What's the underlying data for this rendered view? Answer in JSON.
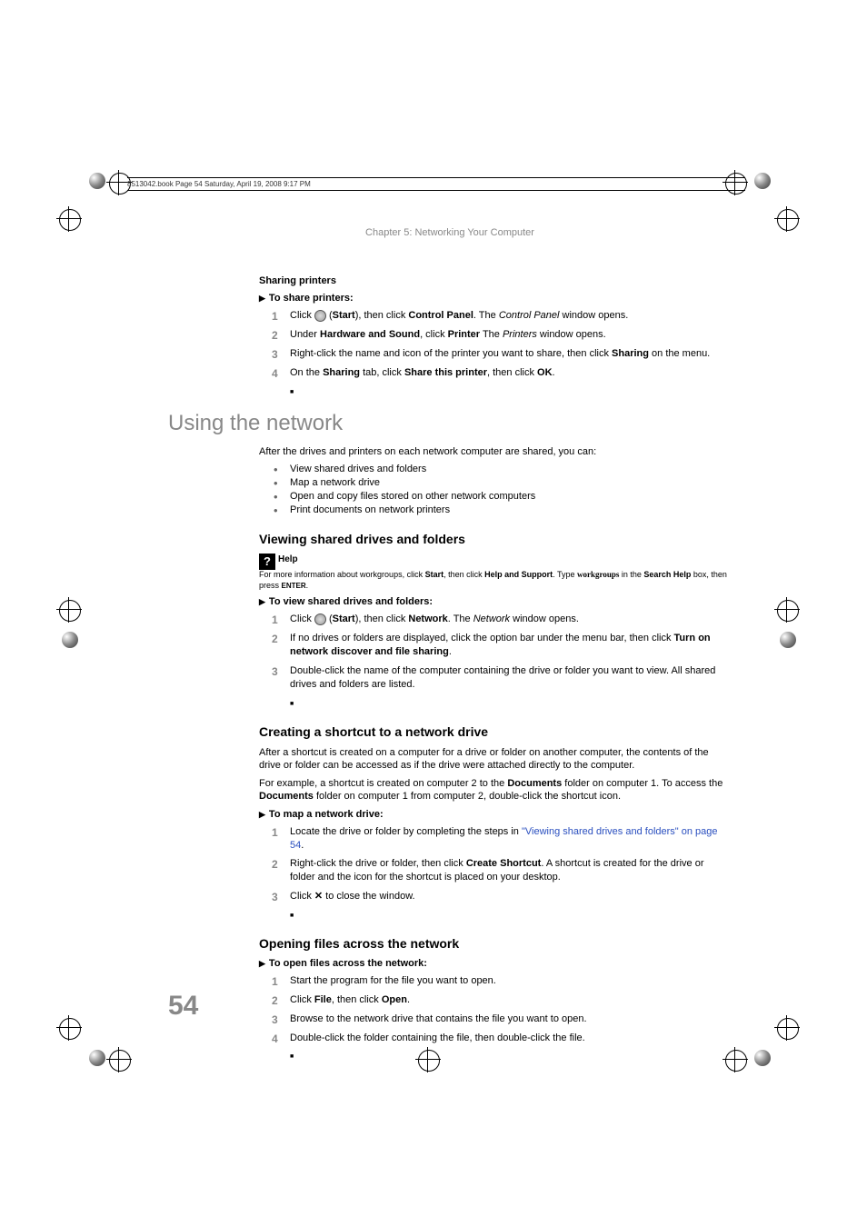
{
  "meta": {
    "bookline": "8513042.book  Page 54  Saturday, April 19, 2008  9:17 PM",
    "chapter_header": "Chapter 5: Networking Your Computer",
    "page_number": "54"
  },
  "sec_sharing": {
    "title": "Sharing printers",
    "proc_title": "To share printers:",
    "steps": [
      {
        "pre": "Click ",
        "icon": "start-orb",
        "post1": " (",
        "b1": "Start",
        "post2": "), then click ",
        "b2": "Control Panel",
        "post3": ". The ",
        "i1": "Control Panel",
        "post4": " window opens."
      },
      {
        "pre": "Under ",
        "b1": "Hardware and Sound",
        "post1": ", click ",
        "b2": "Printer",
        "post2": " The ",
        "i1": "Printers",
        "post3": " window opens."
      },
      {
        "pre": "Right-click the name and icon of the printer you want to share, then click ",
        "b1": "Sharing",
        "post1": " on the menu."
      },
      {
        "pre": "On the ",
        "b1": "Sharing",
        "post1": " tab, click ",
        "b2": "Share this printer",
        "post2": ", then click ",
        "b3": "OK",
        "post3": "."
      }
    ]
  },
  "sec_using": {
    "title": "Using the network",
    "intro": "After the drives and printers on each network computer are shared, you can:",
    "bullets": [
      "View shared drives and folders",
      "Map a network drive",
      "Open and copy files stored on other network computers",
      "Print documents on network printers"
    ]
  },
  "sec_viewing": {
    "title": "Viewing shared drives and folders",
    "help": {
      "title": "Help",
      "t1": "For more information about workgroups, click ",
      "b1": "Start",
      "t2": ", then click ",
      "b2": "Help and Support",
      "t3": ". Type ",
      "kw": "workgroups",
      "t4": " in the ",
      "b3": "Search Help",
      "t5": " box, then press ",
      "key": "ENTER",
      "t6": "."
    },
    "proc_title": "To view shared drives and folders:",
    "steps": [
      {
        "pre": "Click ",
        "icon": "start-orb",
        "post1": " (",
        "b1": "Start",
        "post2": "), then click ",
        "b2": "Network",
        "post3": ". The ",
        "i1": "Network",
        "post4": " window opens."
      },
      {
        "pre": "If no drives or folders are displayed, click the option bar under the menu bar, then click ",
        "b1": "Turn on network discover and file sharing",
        "post1": "."
      },
      {
        "pre": "Double-click the name of the computer containing the drive or folder you want to view. All shared drives and folders are listed."
      }
    ]
  },
  "sec_shortcut": {
    "title": "Creating a shortcut to a network drive",
    "p1": "After a shortcut is created on a computer for a drive or folder on another computer, the contents of the drive or folder can be accessed as if the drive were attached directly to the computer.",
    "p2a": "For example, a shortcut is created on computer 2 to the ",
    "p2b": "Documents",
    "p2c": " folder on computer 1. To access the ",
    "p2d": "Documents",
    "p2e": " folder on computer 1 from computer 2, double-click the shortcut icon.",
    "proc_title": "To map a network drive:",
    "steps": [
      {
        "pre": "Locate the drive or folder by completing the steps in ",
        "link": "\"Viewing shared drives and folders\" on page 54",
        "post1": "."
      },
      {
        "pre": "Right-click the drive or folder, then click ",
        "b1": "Create Shortcut",
        "post1": ". A shortcut is created for the drive or folder and the icon for the shortcut is placed on your desktop."
      },
      {
        "pre": "Click ",
        "x": "✕",
        "post1": " to close the window."
      }
    ]
  },
  "sec_open": {
    "title": "Opening files across the network",
    "proc_title": "To open files across the network:",
    "steps": [
      {
        "pre": "Start the program for the file you want to open."
      },
      {
        "pre": "Click ",
        "b1": "File",
        "post1": ", then click ",
        "b2": "Open",
        "post2": "."
      },
      {
        "pre": "Browse to the network drive that contains the file you want to open."
      },
      {
        "pre": "Double-click the folder containing the file, then double-click the file."
      }
    ]
  }
}
